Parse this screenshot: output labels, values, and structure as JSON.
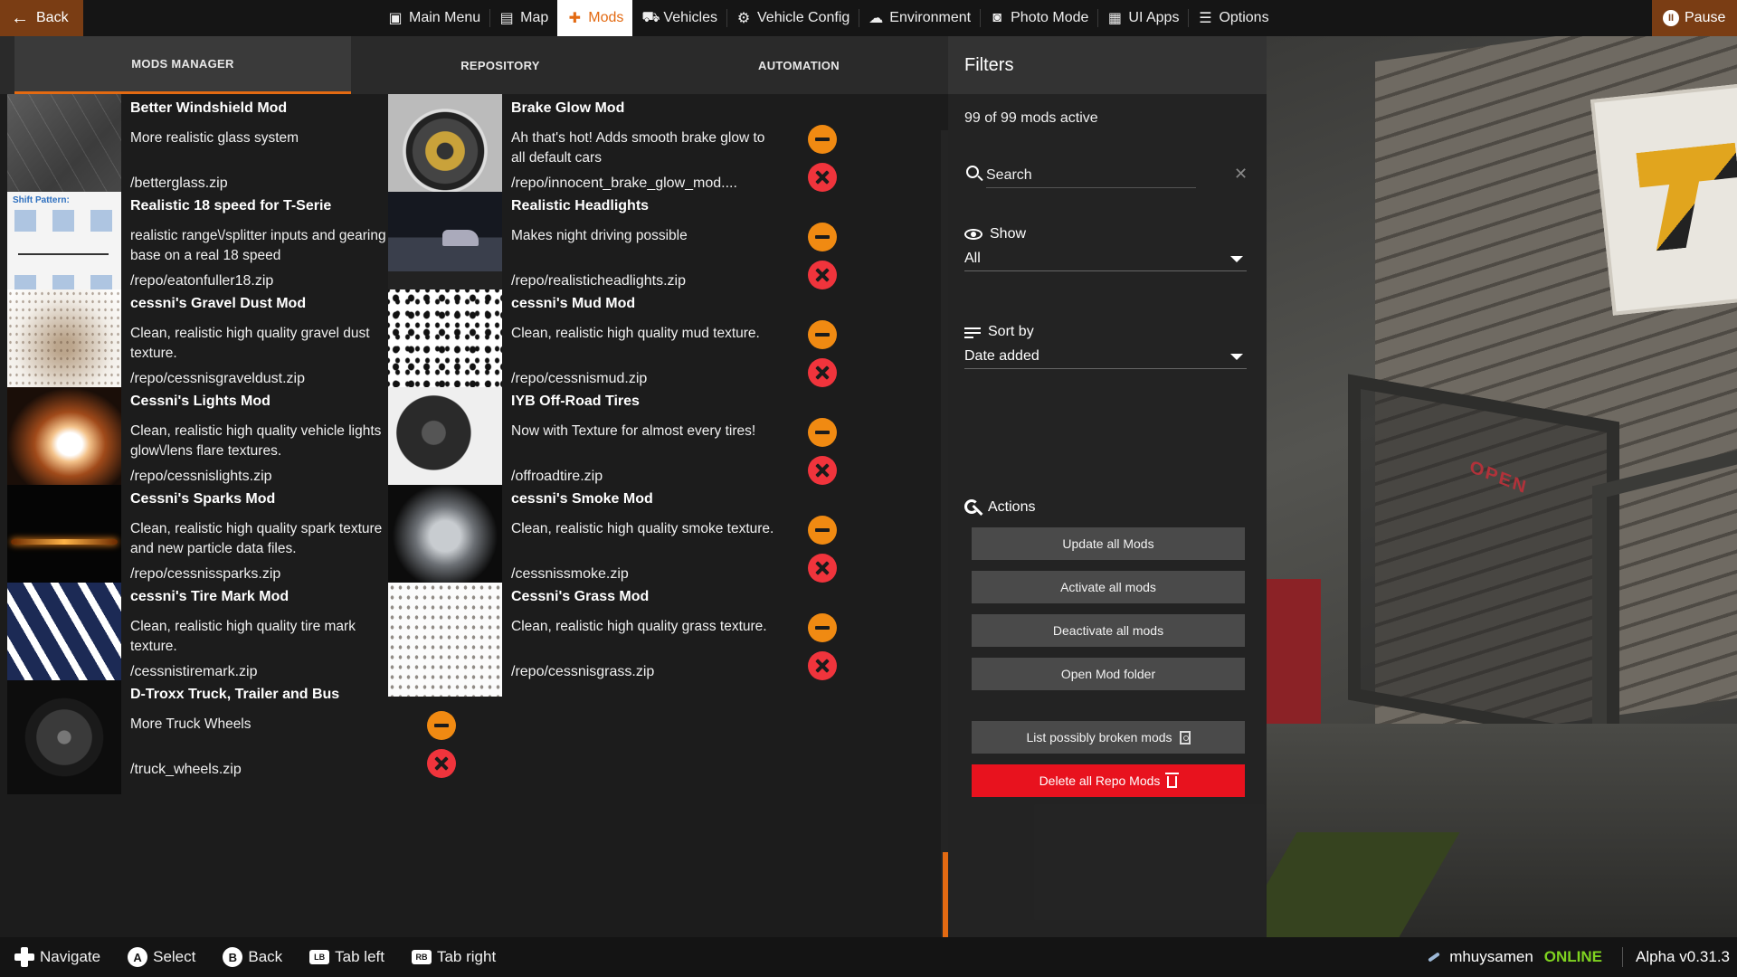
{
  "topbar": {
    "back_label": "Back",
    "pause_label": "Pause",
    "nav": [
      {
        "label": "Main Menu",
        "icon": "main-menu-icon",
        "glyph": "▣"
      },
      {
        "label": "Map",
        "icon": "map-icon",
        "glyph": "▤"
      },
      {
        "label": "Mods",
        "icon": "puzzle-icon",
        "glyph": "✚"
      },
      {
        "label": "Vehicles",
        "icon": "car-icon",
        "glyph": "⛟"
      },
      {
        "label": "Vehicle Config",
        "icon": "engine-icon",
        "glyph": "⚙"
      },
      {
        "label": "Environment",
        "icon": "weather-icon",
        "glyph": "☁"
      },
      {
        "label": "Photo Mode",
        "icon": "camera-icon",
        "glyph": "◙"
      },
      {
        "label": "UI Apps",
        "icon": "ui-apps-icon",
        "glyph": "▦"
      },
      {
        "label": "Options",
        "icon": "options-icon",
        "glyph": "☰"
      }
    ],
    "active": "Mods",
    "accent_color": "#e36a12",
    "button_bg": "#7a3d14"
  },
  "tabs": {
    "mods_manager": "MODS MANAGER",
    "repository": "REPOSITORY",
    "automation": "AUTOMATION"
  },
  "mods": [
    {
      "name": "Better Windshield Mod",
      "desc": "More realistic glass system",
      "path": "/betterglass.zip",
      "thumb": "glass"
    },
    {
      "name": "Brake Glow Mod",
      "desc": "Ah that's hot! Adds smooth brake glow to all default cars",
      "path": "/repo/innocent_brake_glow_mod....",
      "thumb": "brake"
    },
    {
      "name": "Realistic 18 speed for T-Serie",
      "desc": "realistic range\\/splitter inputs and gearing base on a real 18 speed",
      "path": "/repo/eatonfuller18.zip",
      "thumb": "shift",
      "thumb_label": "Shift Pattern:"
    },
    {
      "name": "Realistic Headlights",
      "desc": "Makes night driving possible",
      "path": "/repo/realisticheadlights.zip",
      "thumb": "head"
    },
    {
      "name": "cessni's Gravel Dust Mod",
      "desc": "Clean, realistic high quality gravel dust texture.",
      "path": "/repo/cessnisgraveldust.zip",
      "thumb": "gravel"
    },
    {
      "name": "cessni's Mud Mod",
      "desc": "Clean, realistic high quality mud texture.",
      "path": "/repo/cessnismud.zip",
      "thumb": "mud"
    },
    {
      "name": "Cessni's Lights Mod",
      "desc": "Clean, realistic high quality vehicle lights glow\\/lens flare textures.",
      "path": "/repo/cessnislights.zip",
      "thumb": "lights"
    },
    {
      "name": "IYB Off-Road Tires",
      "desc": "Now with Texture for almost every tires!",
      "path": "/offroadtire.zip",
      "thumb": "tires"
    },
    {
      "name": "Cessni's Sparks Mod",
      "desc": "Clean, realistic high quality spark texture and new particle data files.",
      "path": "/repo/cessnissparks.zip",
      "thumb": "sparks"
    },
    {
      "name": "cessni's Smoke Mod",
      "desc": "Clean, realistic high quality smoke texture.",
      "path": "/cessnissmoke.zip",
      "thumb": "smoke"
    },
    {
      "name": "cessni's Tire Mark Mod",
      "desc": "Clean, realistic high quality tire mark texture.",
      "path": "/cessnistiremark.zip",
      "thumb": "tire"
    },
    {
      "name": "Cessni's Grass Mod",
      "desc": "Clean, realistic high quality grass texture.",
      "path": "/repo/cessnisgrass.zip",
      "thumb": "grass"
    },
    {
      "name": "D-Troxx Truck, Trailer and Bus",
      "desc": "More Truck Wheels",
      "path": "/truck_wheels.zip",
      "thumb": "wheel"
    }
  ],
  "filters": {
    "title": "Filters",
    "active_count": "99 of 99 mods active",
    "search_placeholder": "Search",
    "show_label": "Show",
    "show_value": "All",
    "sort_label": "Sort by",
    "sort_value": "Date added",
    "actions_label": "Actions",
    "actions": {
      "update_all": "Update all Mods",
      "activate_all": "Activate all mods",
      "deactivate_all": "Deactivate all mods",
      "open_folder": "Open Mod folder",
      "list_broken": "List possibly broken mods",
      "delete_repo": "Delete all Repo Mods"
    },
    "danger_color": "#e8121e"
  },
  "bottombar": {
    "hints": [
      {
        "key": "✚",
        "label": "Navigate",
        "kind": "pad"
      },
      {
        "key": "A",
        "label": "Select",
        "kind": "circle"
      },
      {
        "key": "B",
        "label": "Back",
        "kind": "circle"
      },
      {
        "key": "LB",
        "label": "Tab left",
        "kind": "rect"
      },
      {
        "key": "RB",
        "label": "Tab right",
        "kind": "rect"
      }
    ],
    "username": "mhuysamen",
    "online_status": "ONLINE",
    "online_color": "#7fd320",
    "version": "Alpha v0.31.3"
  }
}
